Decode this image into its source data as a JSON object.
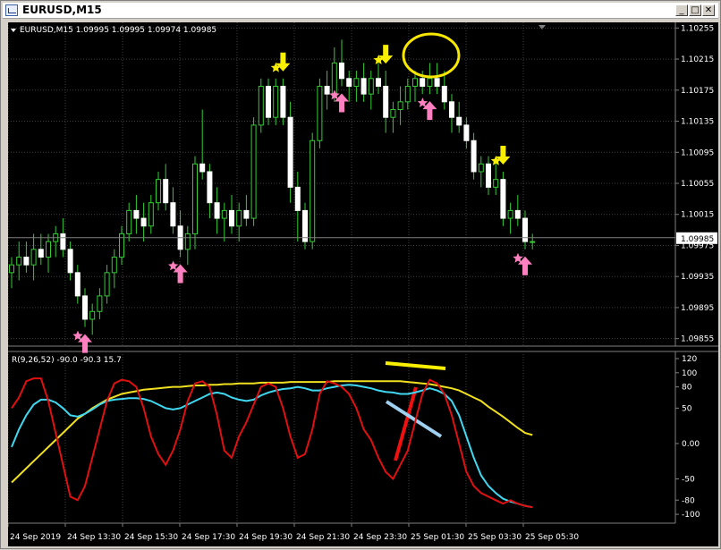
{
  "window": {
    "title": "EURUSD,M15",
    "min_btn": "_",
    "max_btn": "□",
    "close_btn": "✕"
  },
  "symbol_info": {
    "text": "EURUSD,M15  1.09995 1.09995 1.09974 1.09985"
  },
  "current_price_label": "1.09985",
  "price_axis": [
    "1.10255",
    "1.10215",
    "1.10175",
    "1.10135",
    "1.10095",
    "1.10055",
    "1.10015",
    "1.09975",
    "1.09935",
    "1.09895",
    "1.09855"
  ],
  "indicator": {
    "label": "R(9,26,52) -90.0 -90.3 15.7",
    "axis": [
      "120",
      "100",
      "80",
      "50",
      "0.00",
      "-50",
      "-80",
      "-100"
    ]
  },
  "time_axis": [
    "24 Sep 2019",
    "24 Sep 13:30",
    "24 Sep 15:30",
    "24 Sep 17:30",
    "24 Sep 19:30",
    "24 Sep 21:30",
    "24 Sep 23:30",
    "25 Sep 01:30",
    "25 Sep 03:30",
    "25 Sep 05:30"
  ],
  "colors": {
    "background": "#000000",
    "bull_candle": "#ffffff",
    "bear_candle": "#ffffff",
    "wick": "#33cc33",
    "red_line": "#e01010",
    "cyan_line": "#40d8f0",
    "yellow_line": "#f0e020",
    "buy_arrow": "#ff80c0",
    "sell_arrow": "#f8f000"
  },
  "chart_data": {
    "type": "candlestick",
    "ylim": [
      1.0985,
      1.1026
    ],
    "ohlc": [
      [
        1.0994,
        1.0996,
        1.0992,
        1.0995
      ],
      [
        1.0995,
        1.0998,
        1.0993,
        1.0996
      ],
      [
        1.0996,
        1.0998,
        1.0994,
        1.0995
      ],
      [
        1.0995,
        1.0999,
        1.0993,
        1.0997
      ],
      [
        1.0997,
        1.0999,
        1.0995,
        1.0996
      ],
      [
        1.0996,
        1.0999,
        1.0994,
        1.0998
      ],
      [
        1.0998,
        1.1,
        1.0996,
        1.0999
      ],
      [
        1.0999,
        1.1001,
        1.0996,
        1.0997
      ],
      [
        1.0997,
        1.0998,
        1.0993,
        1.0994
      ],
      [
        1.0994,
        1.0995,
        1.099,
        1.0991
      ],
      [
        1.0991,
        1.0992,
        1.0987,
        1.0988
      ],
      [
        1.0988,
        1.099,
        1.0986,
        1.0989
      ],
      [
        1.0989,
        1.0992,
        1.0988,
        1.0991
      ],
      [
        1.0991,
        1.0995,
        1.099,
        1.0994
      ],
      [
        1.0994,
        1.0997,
        1.0992,
        1.0996
      ],
      [
        1.0996,
        1.1,
        1.0995,
        1.0999
      ],
      [
        1.0999,
        1.1003,
        1.0998,
        1.1002
      ],
      [
        1.1002,
        1.1004,
        1.0999,
        1.1001
      ],
      [
        1.1001,
        1.1003,
        1.0998,
        1.1
      ],
      [
        1.1,
        1.1004,
        1.0999,
        1.1003
      ],
      [
        1.1003,
        1.1007,
        1.1002,
        1.1006
      ],
      [
        1.1006,
        1.1008,
        1.1002,
        1.1003
      ],
      [
        1.1003,
        1.1005,
        1.0999,
        1.1
      ],
      [
        1.1,
        1.1002,
        1.0996,
        1.0997
      ],
      [
        1.0997,
        1.1,
        1.0995,
        1.0999
      ],
      [
        1.0999,
        1.1009,
        1.0997,
        1.1008
      ],
      [
        1.1008,
        1.1015,
        1.1006,
        1.1007
      ],
      [
        1.1007,
        1.1008,
        1.1001,
        1.1003
      ],
      [
        1.1003,
        1.1005,
        1.0999,
        1.1001
      ],
      [
        1.1001,
        1.1003,
        1.0998,
        1.1002
      ],
      [
        1.1002,
        1.1004,
        1.0999,
        1.1
      ],
      [
        1.1,
        1.1003,
        1.0998,
        1.1002
      ],
      [
        1.1002,
        1.1004,
        1.1,
        1.1001
      ],
      [
        1.1001,
        1.1014,
        1.1,
        1.1013
      ],
      [
        1.1013,
        1.1019,
        1.1012,
        1.1018
      ],
      [
        1.1018,
        1.1019,
        1.1013,
        1.1014
      ],
      [
        1.1014,
        1.1019,
        1.1013,
        1.1018
      ],
      [
        1.1018,
        1.1019,
        1.1013,
        1.1014
      ],
      [
        1.1014,
        1.1016,
        1.1003,
        1.1005
      ],
      [
        1.1005,
        1.1007,
        1.0998,
        1.1002
      ],
      [
        1.1002,
        1.1003,
        1.0997,
        1.0998
      ],
      [
        1.0998,
        1.1012,
        1.0997,
        1.1011
      ],
      [
        1.1011,
        1.1019,
        1.101,
        1.1018
      ],
      [
        1.1018,
        1.102,
        1.1015,
        1.1017
      ],
      [
        1.1017,
        1.1023,
        1.1016,
        1.1021
      ],
      [
        1.1021,
        1.1024,
        1.1018,
        1.1019
      ],
      [
        1.1019,
        1.102,
        1.1016,
        1.1018
      ],
      [
        1.1018,
        1.102,
        1.1016,
        1.1019
      ],
      [
        1.1019,
        1.1021,
        1.1016,
        1.1017
      ],
      [
        1.1017,
        1.102,
        1.1015,
        1.1019
      ],
      [
        1.1019,
        1.1021,
        1.1017,
        1.1018
      ],
      [
        1.1018,
        1.102,
        1.1012,
        1.1014
      ],
      [
        1.1014,
        1.1016,
        1.1012,
        1.1015
      ],
      [
        1.1015,
        1.1018,
        1.1013,
        1.1016
      ],
      [
        1.1016,
        1.1019,
        1.1015,
        1.1018
      ],
      [
        1.1018,
        1.102,
        1.1016,
        1.1019
      ],
      [
        1.1019,
        1.102,
        1.1017,
        1.1018
      ],
      [
        1.1018,
        1.1021,
        1.1017,
        1.1019
      ],
      [
        1.1019,
        1.1021,
        1.1017,
        1.1018
      ],
      [
        1.1018,
        1.102,
        1.1015,
        1.1016
      ],
      [
        1.1016,
        1.1017,
        1.1012,
        1.1014
      ],
      [
        1.1014,
        1.1016,
        1.1012,
        1.1013
      ],
      [
        1.1013,
        1.1014,
        1.101,
        1.1011
      ],
      [
        1.1011,
        1.1012,
        1.1006,
        1.1007
      ],
      [
        1.1007,
        1.1009,
        1.1005,
        1.1008
      ],
      [
        1.1008,
        1.1009,
        1.1004,
        1.1005
      ],
      [
        1.1005,
        1.1008,
        1.1004,
        1.1006
      ],
      [
        1.1006,
        1.1007,
        1.1,
        1.1001
      ],
      [
        1.1001,
        1.1003,
        1.0999,
        1.1002
      ],
      [
        1.1002,
        1.1004,
        1.1,
        1.1001
      ],
      [
        1.1001,
        1.1002,
        1.0997,
        1.0998
      ],
      [
        1.0998,
        1.0999,
        1.0997,
        1.0998
      ]
    ],
    "signals": [
      {
        "type": "buy",
        "bar": 10
      },
      {
        "type": "buy",
        "bar": 23
      },
      {
        "type": "sell",
        "bar": 37
      },
      {
        "type": "buy",
        "bar": 45
      },
      {
        "type": "sell",
        "bar": 51
      },
      {
        "type": "buy",
        "bar": 57
      },
      {
        "type": "sell",
        "bar": 67
      },
      {
        "type": "buy",
        "bar": 70
      }
    ],
    "indicator": {
      "ylim": [
        -110,
        125
      ],
      "red": [
        50,
        65,
        88,
        92,
        92,
        60,
        15,
        -30,
        -75,
        -80,
        -60,
        -20,
        20,
        60,
        85,
        90,
        88,
        80,
        50,
        10,
        -15,
        -30,
        -10,
        20,
        60,
        85,
        88,
        80,
        40,
        -10,
        -20,
        10,
        30,
        55,
        80,
        85,
        80,
        50,
        10,
        -20,
        -15,
        20,
        70,
        88,
        85,
        80,
        70,
        50,
        20,
        5,
        -20,
        -40,
        -50,
        -30,
        -10,
        30,
        70,
        90,
        85,
        70,
        40,
        0,
        -40,
        -60,
        -70,
        -75,
        -80,
        -85,
        -80,
        -85,
        -88,
        -90
      ],
      "cyan": [
        -5,
        20,
        40,
        55,
        62,
        62,
        58,
        50,
        40,
        38,
        42,
        48,
        55,
        60,
        62,
        63,
        64,
        64,
        63,
        60,
        55,
        50,
        48,
        50,
        55,
        60,
        65,
        70,
        72,
        70,
        65,
        62,
        60,
        62,
        68,
        72,
        75,
        77,
        78,
        80,
        78,
        75,
        75,
        78,
        80,
        82,
        83,
        82,
        80,
        78,
        75,
        73,
        72,
        70,
        70,
        72,
        75,
        78,
        75,
        70,
        60,
        40,
        10,
        -20,
        -45,
        -60,
        -70,
        -78,
        -82,
        -85,
        -88,
        -90
      ],
      "yellow": [
        -55,
        -45,
        -35,
        -25,
        -15,
        -5,
        5,
        15,
        25,
        35,
        42,
        50,
        56,
        62,
        66,
        70,
        72,
        74,
        76,
        77,
        78,
        79,
        80,
        80,
        81,
        82,
        82,
        83,
        83,
        84,
        84,
        85,
        85,
        85,
        86,
        86,
        86,
        86,
        87,
        87,
        87,
        87,
        87,
        87,
        88,
        88,
        88,
        88,
        88,
        88,
        88,
        88,
        88,
        88,
        87,
        86,
        85,
        84,
        82,
        80,
        78,
        75,
        70,
        65,
        60,
        52,
        45,
        38,
        30,
        22,
        15,
        12
      ]
    }
  }
}
